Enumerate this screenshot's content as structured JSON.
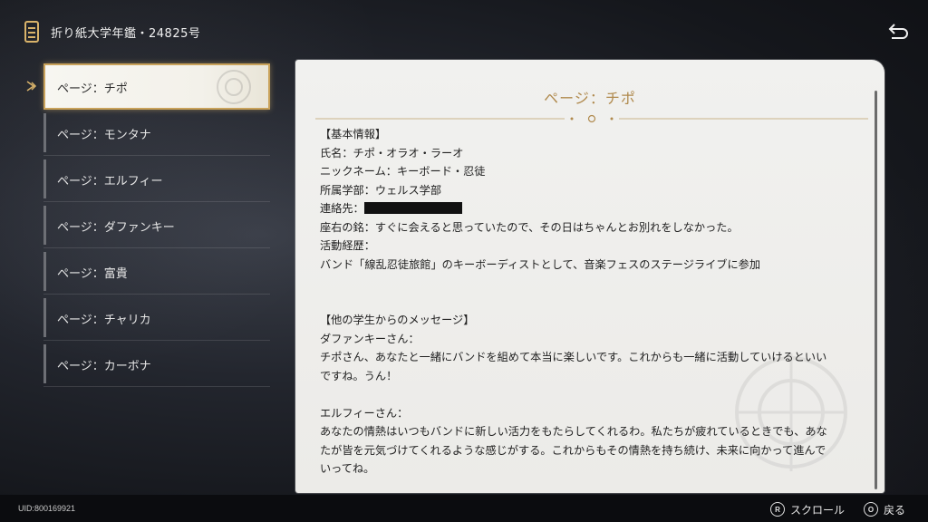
{
  "header": {
    "title": "折り紙大学年鑑・24825号",
    "book_icon": "book-icon",
    "back_icon": "return-arrow-icon"
  },
  "sidebar": {
    "items": [
      {
        "label": "ページ：チポ",
        "active": true
      },
      {
        "label": "ページ：モンタナ",
        "active": false
      },
      {
        "label": "ページ：エルフィー",
        "active": false
      },
      {
        "label": "ページ：ダファンキー",
        "active": false
      },
      {
        "label": "ページ：富貴",
        "active": false
      },
      {
        "label": "ページ：チャリカ",
        "active": false
      },
      {
        "label": "ページ：カーボナ",
        "active": false
      }
    ]
  },
  "panel": {
    "title": "ページ：チポ",
    "lines": [
      "【基本情報】",
      "氏名：チポ・オラオ・ラーオ",
      "ニックネーム：キーボード・忍徒",
      "所属学部：ウェルス学部",
      "連絡先：",
      "座右の銘：すぐに会えると思っていたので、その日はちゃんとお別れをしなかった。",
      "活動経歴：",
      "バンド「線乱忍徒旅館」のキーボーディストとして、音楽フェスのステージライブに参加",
      "",
      "",
      "【他の学生からのメッセージ】",
      "ダファンキーさん：",
      "チポさん、あなたと一緒にバンドを組めて本当に楽しいです。これからも一緒に活動していけるといい",
      "ですね。うん！",
      "",
      "エルフィーさん：",
      "あなたの情熱はいつもバンドに新しい活力をもたらしてくれるわ。私たちが疲れているときでも、あな",
      "たが皆を元気づけてくれるような感じがする。これからもその情熱を持ち続け、未来に向かって進んで",
      "いってね。"
    ]
  },
  "footer": {
    "uid": "UID:800169921",
    "scroll_key": "R",
    "scroll_label": "スクロール",
    "back_key": "O",
    "back_label": "戻る"
  },
  "colors": {
    "accent_gold": "#c9a25a",
    "title_gold": "#b08a4e",
    "panel_bg": "#efeeeb"
  }
}
